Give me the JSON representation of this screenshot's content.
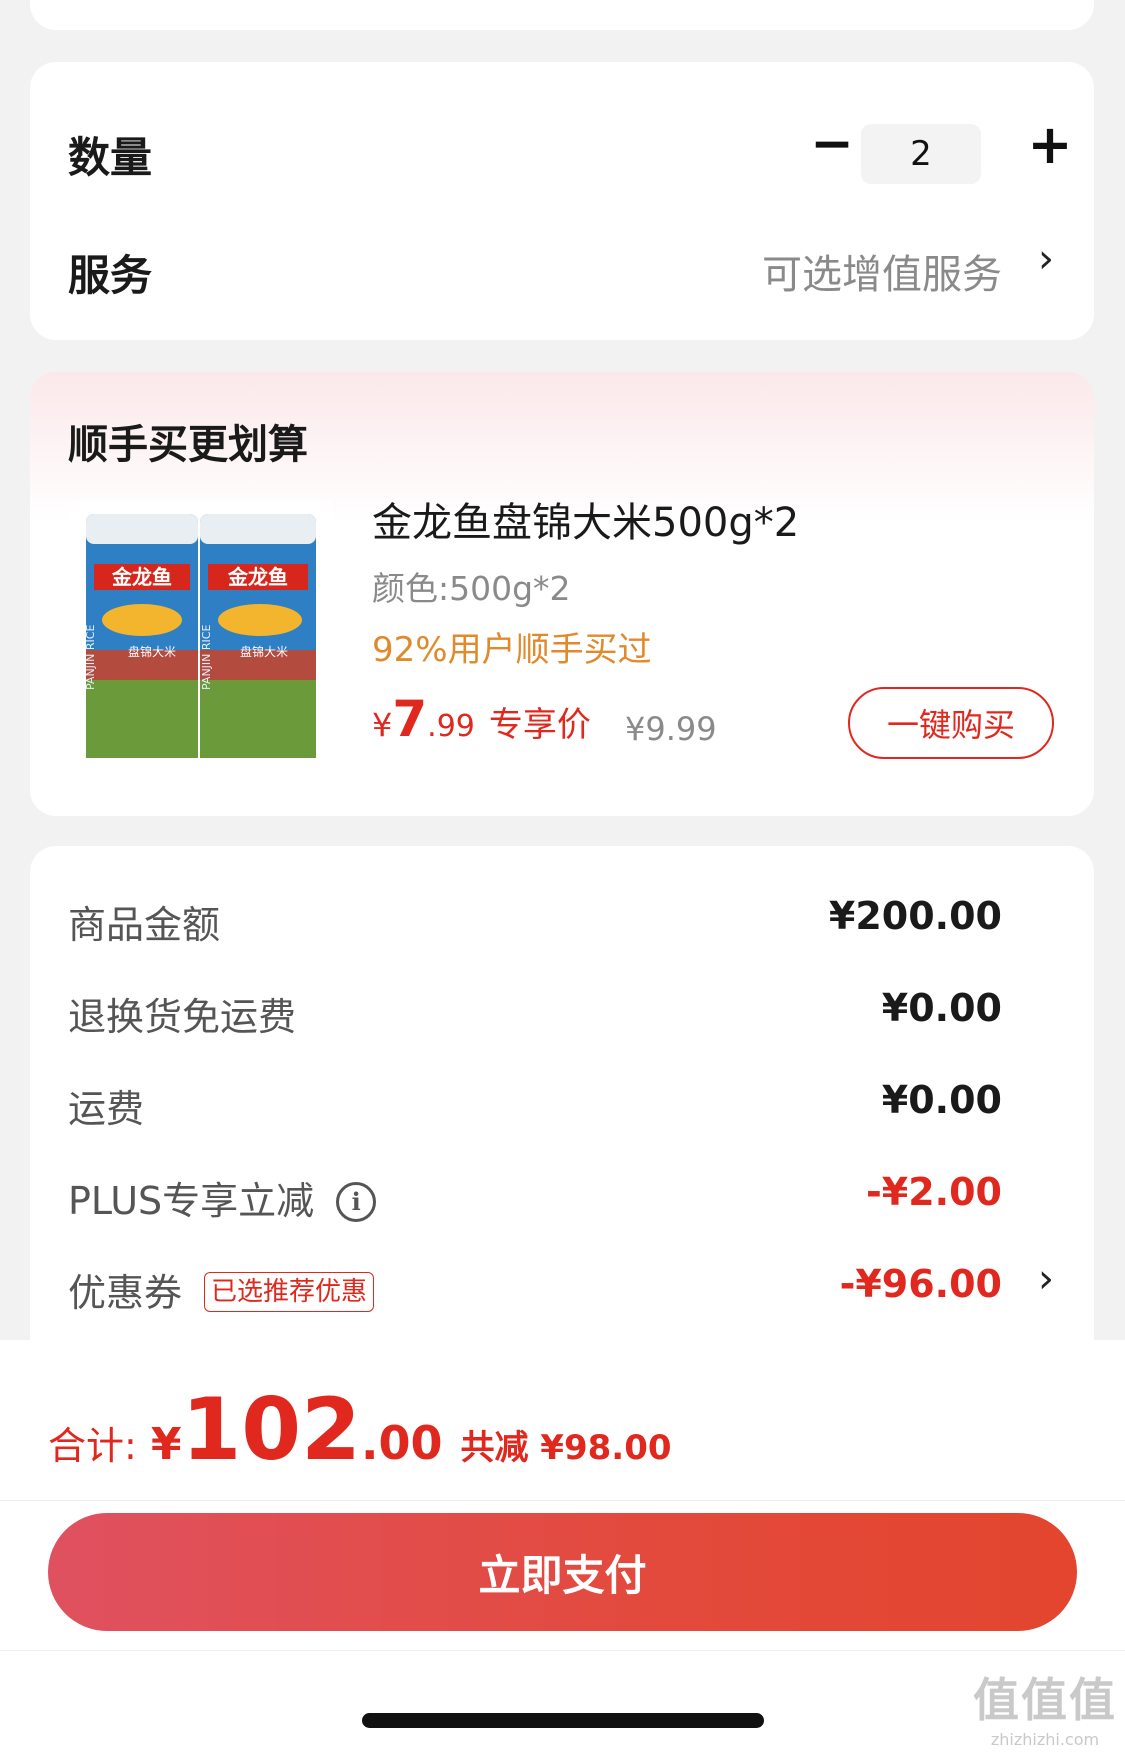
{
  "quantity": {
    "label": "数量",
    "minus_symbol": "−",
    "value": "2",
    "plus_symbol": "+"
  },
  "service": {
    "label": "服务",
    "value": "可选增值服务",
    "chevron": "›"
  },
  "upsell": {
    "title": "顺手买更划算",
    "product": {
      "name": "金龙鱼盘锦大米500g*2",
      "spec": "颜色:500g*2",
      "social_proof": "92%用户顺手买过",
      "price_currency": "¥",
      "price_int": "7",
      "price_dec": ".99",
      "price_tag": "专享价",
      "original_price": "¥9.99",
      "buy_button": "一键购买",
      "image_brand_text": "金龙鱼",
      "image_product_text": "盘锦大米",
      "image_side_text": "PANJIN RICE"
    }
  },
  "summary": {
    "rows": [
      {
        "label": "商品金额",
        "value": "¥200.00"
      },
      {
        "label": "退换货免运费",
        "value": "¥0.00"
      },
      {
        "label": "运费",
        "value": "¥0.00"
      },
      {
        "label": "PLUS专享立减",
        "info_symbol": "i",
        "value": "-¥2.00"
      },
      {
        "label": "优惠券",
        "tag": "已选推荐优惠",
        "value": "-¥96.00",
        "chevron": "›"
      }
    ]
  },
  "total": {
    "label": "合计:",
    "currency": "¥",
    "int": "102",
    "dec": ".00",
    "discount": "共减 ¥98.00"
  },
  "pay_button": "立即支付",
  "watermark": {
    "line1": "值值值",
    "line2": "zhizhizhi.com"
  },
  "colors": {
    "accent_red": "#e0281e",
    "social_orange": "#e08a2c",
    "pay_gradient_start": "#e05160",
    "pay_gradient_end": "#e3452e"
  },
  "icons": [
    "minus-icon",
    "plus-icon",
    "chevron-right-icon",
    "info-icon",
    "home-indicator"
  ]
}
